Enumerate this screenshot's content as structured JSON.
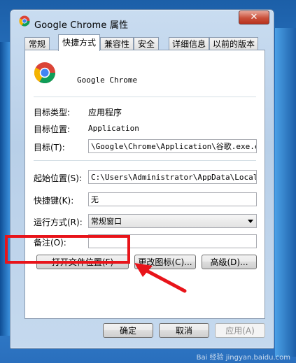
{
  "window": {
    "title": "Google Chrome 属性",
    "close_label": "✕"
  },
  "tabs": [
    {
      "label": "常规"
    },
    {
      "label": "快捷方式"
    },
    {
      "label": "兼容性"
    },
    {
      "label": "安全"
    },
    {
      "label": "详细信息"
    },
    {
      "label": "以前的版本"
    }
  ],
  "shortcut": {
    "name": "Google Chrome",
    "target_type_label": "目标类型:",
    "target_type_value": "应用程序",
    "target_location_label": "目标位置:",
    "target_location_value": "Application",
    "target_label": "目标(T):",
    "target_value": "\\Google\\Chrome\\Application\\谷歌.exe.exe",
    "start_in_label": "起始位置(S):",
    "start_in_value": "C:\\Users\\Administrator\\AppData\\Local\\Go",
    "hotkey_label": "快捷键(K):",
    "hotkey_value": "无",
    "run_label": "运行方式(R):",
    "run_value": "常规窗口",
    "comment_label": "备注(O):",
    "comment_value": ""
  },
  "buttons": {
    "open_location": "打开文件位置(F)",
    "change_icon": "更改图标(C)...",
    "advanced": "高级(D)..."
  },
  "footer": {
    "ok": "确定",
    "cancel": "取消",
    "apply": "应用(A)"
  },
  "watermark": "Bai 经验 jingyan.baidu.com",
  "colors": {
    "highlight": "#e8141a",
    "titlebar": "#c9dcf0"
  },
  "icons": [
    "chrome-icon",
    "close-icon",
    "dropdown-arrow-icon",
    "red-arrow-annotation"
  ]
}
